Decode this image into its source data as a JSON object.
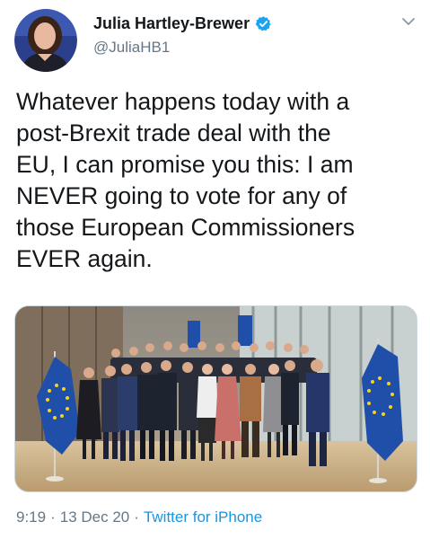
{
  "tweet": {
    "author": {
      "display_name": "Julia Hartley-Brewer",
      "handle": "@JuliaHB1",
      "verified": true
    },
    "text": "Whatever happens today with a\npost-Brexit trade deal with the\nEU, I can promise you this: I am\nNEVER going to vote for any of\nthose European Commissioners\nEVER again.",
    "media": {
      "type": "photo",
      "subject": "group photo of commissioners with EU flags"
    },
    "meta": {
      "time": "9:19",
      "separator": "·",
      "date": "13 Dec 20",
      "source": "Twitter for iPhone"
    }
  },
  "icons": {
    "verified": "verified-badge-icon",
    "menu": "chevron-down-icon"
  },
  "colors": {
    "text": "#14171a",
    "secondary": "#657786",
    "link": "#1b95e0",
    "verified": "#1da1f2",
    "eu_flag": "#1f4fa8",
    "eu_star": "#f7d417"
  }
}
